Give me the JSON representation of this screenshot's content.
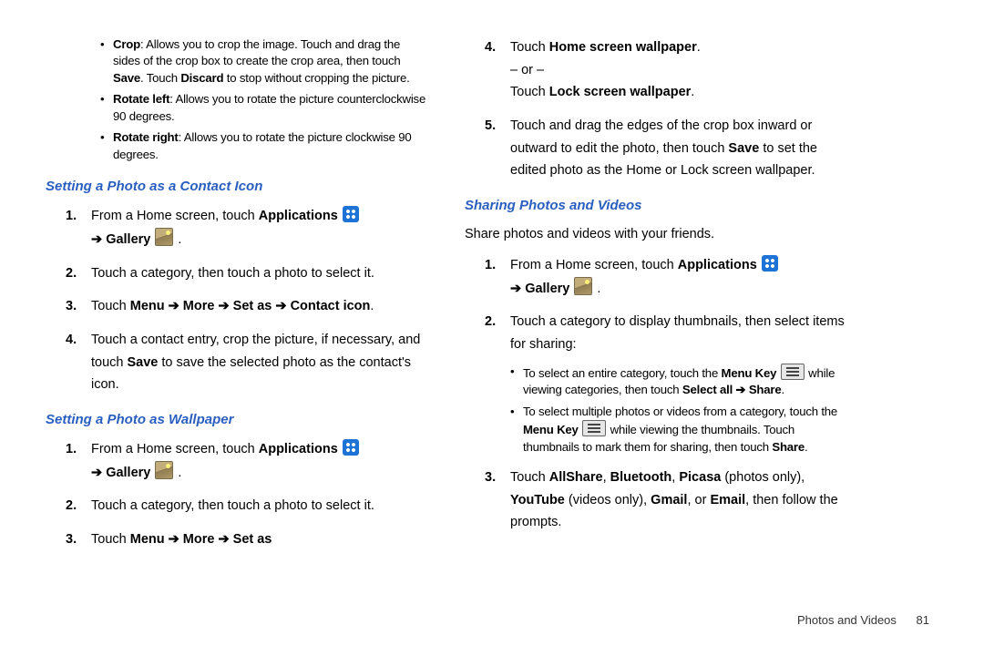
{
  "left": {
    "sub_items": [
      {
        "lead": "Crop",
        "rest": ": Allows you to crop the image. Touch and drag the sides of the crop box to create the crop area, then touch ",
        "b1": "Save",
        "mid": ". Touch ",
        "b2": "Discard",
        "tail": " to stop without cropping the picture."
      },
      {
        "lead": "Rotate left",
        "rest": ": Allows you to rotate the picture counterclockwise 90 degrees."
      },
      {
        "lead": "Rotate right",
        "rest": ": Allows you to rotate the picture clockwise 90 degrees."
      }
    ],
    "h1": "Setting a Photo as a Contact Icon",
    "s1": {
      "pre": "From a Home screen, touch ",
      "apps": "Applications",
      "arrow": " ➔ ",
      "gallery": "Gallery",
      "post": " ."
    },
    "s2": "Touch a category, then touch a photo to select it.",
    "s3": {
      "pre": "Touch ",
      "b": "Menu ➔ More ➔ Set as ➔ Contact icon",
      "post": "."
    },
    "s4": {
      "pre": "Touch a contact entry, crop the picture, if necessary, and touch ",
      "b": "Save",
      "post": " to save the selected photo as the contact's icon."
    },
    "h2": "Setting a Photo as Wallpaper",
    "w1": {
      "pre": "From a Home screen, touch ",
      "apps": "Applications",
      "arrow": " ➔ ",
      "gallery": "Gallery",
      "post": " ."
    },
    "w2": "Touch a category, then touch a photo to select it.",
    "w3": {
      "pre": "Touch ",
      "b": "Menu ➔ More ➔ Set as"
    }
  },
  "right": {
    "r4a": {
      "pre": "Touch ",
      "b": "Home screen wallpaper",
      "post": "."
    },
    "or": "– or –",
    "r4b": {
      "pre": "Touch ",
      "b": "Lock screen wallpaper",
      "post": "."
    },
    "r5": {
      "pre": "Touch and drag the edges of the crop box inward or outward to edit the photo, then touch ",
      "b": "Save",
      "post": " to set the edited photo as the Home or Lock screen wallpaper."
    },
    "h": "Sharing Photos and Videos",
    "intro": "Share photos and videos with your friends.",
    "sh1": {
      "pre": "From a Home screen, touch ",
      "apps": "Applications",
      "arrow": " ➔ ",
      "gallery": "Gallery",
      "post": " ."
    },
    "sh2": "Touch a category to display thumbnails, then select items for sharing:",
    "sub1": {
      "pre": "To select an entire category, touch the ",
      "b": "Menu Key",
      "mid": "  while viewing categories, then touch ",
      "b2": "Select all ➔ Share",
      "post": "."
    },
    "sub2": {
      "pre": "To select multiple photos or videos from a category, touch the ",
      "b": "Menu Key",
      "mid": "  while viewing the thumbnails. Touch thumbnails to mark them for sharing, then touch ",
      "b2": "Share",
      "post": "."
    },
    "sh3": {
      "pre": "Touch ",
      "a": "AllShare",
      "c1": ", ",
      "b": "Bluetooth",
      "c2": ", ",
      "p": "Picasa",
      "pp": " (photos only), ",
      "y": "YouTube",
      "yp": " (videos only), ",
      "g": "Gmail",
      "c3": ", or ",
      "e": "Email",
      "post": ", then follow the prompts."
    }
  },
  "footer": {
    "section": "Photos and Videos",
    "page": "81"
  }
}
